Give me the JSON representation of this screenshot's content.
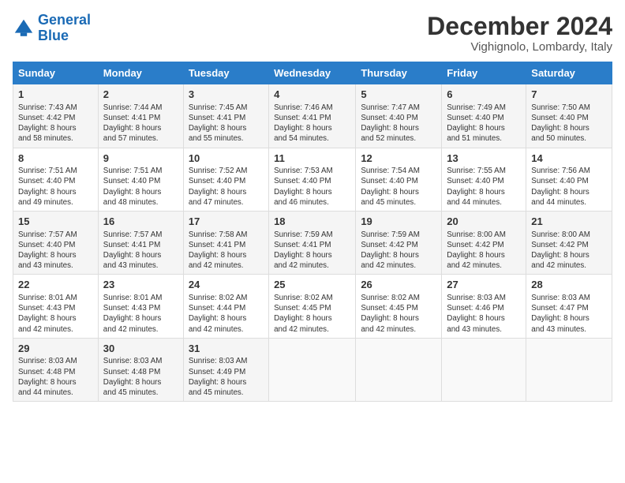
{
  "header": {
    "logo_line1": "General",
    "logo_line2": "Blue",
    "month": "December 2024",
    "location": "Vighignolo, Lombardy, Italy"
  },
  "columns": [
    "Sunday",
    "Monday",
    "Tuesday",
    "Wednesday",
    "Thursday",
    "Friday",
    "Saturday"
  ],
  "weeks": [
    [
      {
        "day": "1",
        "info": "Sunrise: 7:43 AM\nSunset: 4:42 PM\nDaylight: 8 hours\nand 58 minutes."
      },
      {
        "day": "2",
        "info": "Sunrise: 7:44 AM\nSunset: 4:41 PM\nDaylight: 8 hours\nand 57 minutes."
      },
      {
        "day": "3",
        "info": "Sunrise: 7:45 AM\nSunset: 4:41 PM\nDaylight: 8 hours\nand 55 minutes."
      },
      {
        "day": "4",
        "info": "Sunrise: 7:46 AM\nSunset: 4:41 PM\nDaylight: 8 hours\nand 54 minutes."
      },
      {
        "day": "5",
        "info": "Sunrise: 7:47 AM\nSunset: 4:40 PM\nDaylight: 8 hours\nand 52 minutes."
      },
      {
        "day": "6",
        "info": "Sunrise: 7:49 AM\nSunset: 4:40 PM\nDaylight: 8 hours\nand 51 minutes."
      },
      {
        "day": "7",
        "info": "Sunrise: 7:50 AM\nSunset: 4:40 PM\nDaylight: 8 hours\nand 50 minutes."
      }
    ],
    [
      {
        "day": "8",
        "info": "Sunrise: 7:51 AM\nSunset: 4:40 PM\nDaylight: 8 hours\nand 49 minutes."
      },
      {
        "day": "9",
        "info": "Sunrise: 7:51 AM\nSunset: 4:40 PM\nDaylight: 8 hours\nand 48 minutes."
      },
      {
        "day": "10",
        "info": "Sunrise: 7:52 AM\nSunset: 4:40 PM\nDaylight: 8 hours\nand 47 minutes."
      },
      {
        "day": "11",
        "info": "Sunrise: 7:53 AM\nSunset: 4:40 PM\nDaylight: 8 hours\nand 46 minutes."
      },
      {
        "day": "12",
        "info": "Sunrise: 7:54 AM\nSunset: 4:40 PM\nDaylight: 8 hours\nand 45 minutes."
      },
      {
        "day": "13",
        "info": "Sunrise: 7:55 AM\nSunset: 4:40 PM\nDaylight: 8 hours\nand 44 minutes."
      },
      {
        "day": "14",
        "info": "Sunrise: 7:56 AM\nSunset: 4:40 PM\nDaylight: 8 hours\nand 44 minutes."
      }
    ],
    [
      {
        "day": "15",
        "info": "Sunrise: 7:57 AM\nSunset: 4:40 PM\nDaylight: 8 hours\nand 43 minutes."
      },
      {
        "day": "16",
        "info": "Sunrise: 7:57 AM\nSunset: 4:41 PM\nDaylight: 8 hours\nand 43 minutes."
      },
      {
        "day": "17",
        "info": "Sunrise: 7:58 AM\nSunset: 4:41 PM\nDaylight: 8 hours\nand 42 minutes."
      },
      {
        "day": "18",
        "info": "Sunrise: 7:59 AM\nSunset: 4:41 PM\nDaylight: 8 hours\nand 42 minutes."
      },
      {
        "day": "19",
        "info": "Sunrise: 7:59 AM\nSunset: 4:42 PM\nDaylight: 8 hours\nand 42 minutes."
      },
      {
        "day": "20",
        "info": "Sunrise: 8:00 AM\nSunset: 4:42 PM\nDaylight: 8 hours\nand 42 minutes."
      },
      {
        "day": "21",
        "info": "Sunrise: 8:00 AM\nSunset: 4:42 PM\nDaylight: 8 hours\nand 42 minutes."
      }
    ],
    [
      {
        "day": "22",
        "info": "Sunrise: 8:01 AM\nSunset: 4:43 PM\nDaylight: 8 hours\nand 42 minutes."
      },
      {
        "day": "23",
        "info": "Sunrise: 8:01 AM\nSunset: 4:43 PM\nDaylight: 8 hours\nand 42 minutes."
      },
      {
        "day": "24",
        "info": "Sunrise: 8:02 AM\nSunset: 4:44 PM\nDaylight: 8 hours\nand 42 minutes."
      },
      {
        "day": "25",
        "info": "Sunrise: 8:02 AM\nSunset: 4:45 PM\nDaylight: 8 hours\nand 42 minutes."
      },
      {
        "day": "26",
        "info": "Sunrise: 8:02 AM\nSunset: 4:45 PM\nDaylight: 8 hours\nand 42 minutes."
      },
      {
        "day": "27",
        "info": "Sunrise: 8:03 AM\nSunset: 4:46 PM\nDaylight: 8 hours\nand 43 minutes."
      },
      {
        "day": "28",
        "info": "Sunrise: 8:03 AM\nSunset: 4:47 PM\nDaylight: 8 hours\nand 43 minutes."
      }
    ],
    [
      {
        "day": "29",
        "info": "Sunrise: 8:03 AM\nSunset: 4:48 PM\nDaylight: 8 hours\nand 44 minutes."
      },
      {
        "day": "30",
        "info": "Sunrise: 8:03 AM\nSunset: 4:48 PM\nDaylight: 8 hours\nand 45 minutes."
      },
      {
        "day": "31",
        "info": "Sunrise: 8:03 AM\nSunset: 4:49 PM\nDaylight: 8 hours\nand 45 minutes."
      },
      {
        "day": "",
        "info": ""
      },
      {
        "day": "",
        "info": ""
      },
      {
        "day": "",
        "info": ""
      },
      {
        "day": "",
        "info": ""
      }
    ]
  ]
}
